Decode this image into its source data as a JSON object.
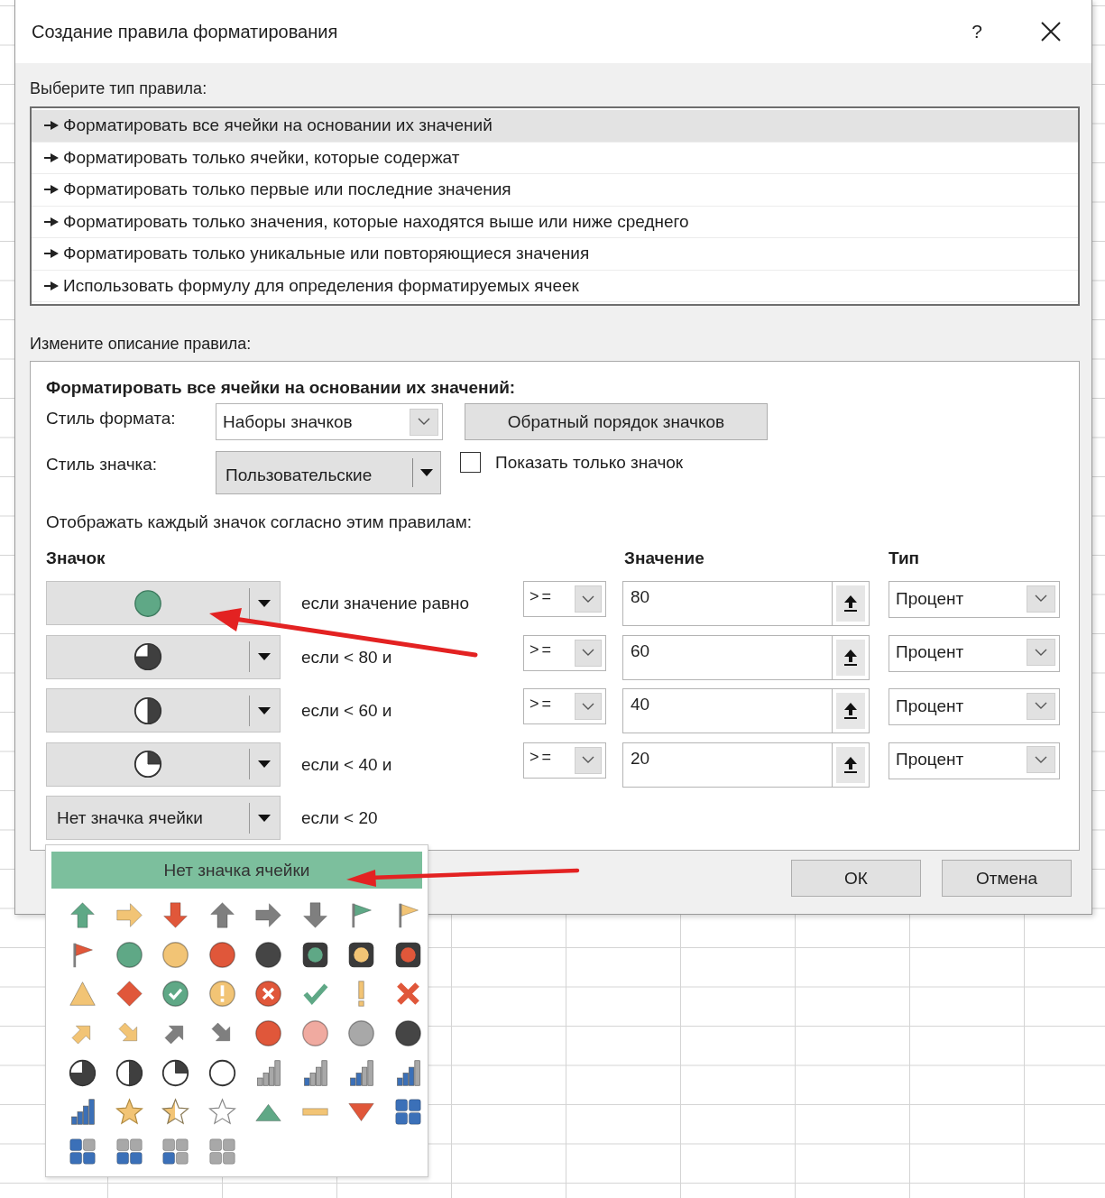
{
  "dialog": {
    "title": "Создание правила форматирования",
    "help": "?"
  },
  "rule_type": {
    "label": "Выберите тип правила:",
    "items": [
      {
        "label": "Форматировать все ячейки на основании их значений",
        "selected": true
      },
      {
        "label": "Форматировать только ячейки, которые содержат",
        "selected": false
      },
      {
        "label": "Форматировать только первые или последние значения",
        "selected": false
      },
      {
        "label": "Форматировать только значения, которые находятся выше или ниже среднего",
        "selected": false
      },
      {
        "label": "Форматировать только уникальные или повторяющиеся значения",
        "selected": false
      },
      {
        "label": "Использовать формулу для определения форматируемых ячеек",
        "selected": false
      }
    ]
  },
  "description": {
    "label": "Измените описание правила:",
    "heading": "Форматировать все ячейки на основании их значений:",
    "format_style": {
      "label": "Стиль формата:",
      "value": "Наборы значков"
    },
    "reverse_button": "Обратный порядок значков",
    "icon_style": {
      "label": "Стиль значка:",
      "value": "Пользовательские"
    },
    "show_icon_only": {
      "label": "Показать только значок",
      "checked": false
    },
    "rules_caption": "Отображать каждый значок согласно этим правилам:",
    "columns": [
      "Значок",
      "Значение",
      "Тип"
    ],
    "rules": [
      {
        "kind": "circle",
        "condition": "если значение равно",
        "operator": ">=",
        "value": "80",
        "type": "Процент"
      },
      {
        "kind": "threequarter",
        "condition": "если < 80 и",
        "operator": ">=",
        "value": "60",
        "type": "Процент"
      },
      {
        "kind": "half",
        "condition": "если < 60 и",
        "operator": ">=",
        "value": "40",
        "type": "Процент"
      },
      {
        "kind": "quarter",
        "condition": "если < 40 и",
        "operator": ">=",
        "value": "20",
        "type": "Процент"
      },
      {
        "kind": "none",
        "label": "Нет значка ячейки",
        "condition": "если < 20"
      }
    ]
  },
  "buttons": [
    {
      "label": "ОК"
    },
    {
      "label": "Отмена"
    }
  ],
  "icon_menu": {
    "header": {
      "label": "Нет значка ячейки",
      "selected": true
    }
  }
}
